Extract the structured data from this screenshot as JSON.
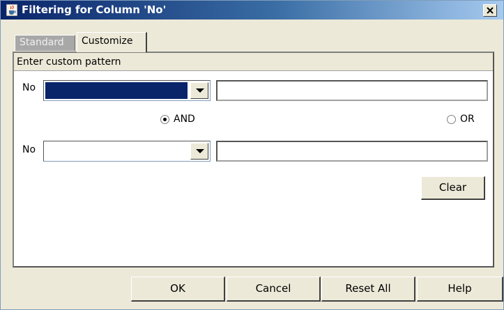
{
  "window": {
    "title": "Filtering for Column 'No'",
    "icon": "java-cup-icon",
    "close_symbol": "✕"
  },
  "tabs": [
    {
      "label": "Standard",
      "active": false
    },
    {
      "label": "Customize",
      "active": true
    }
  ],
  "panel": {
    "header": "Enter custom pattern",
    "row1": {
      "label": "No",
      "operator_value": "",
      "pattern_value": ""
    },
    "logic": {
      "and_label": "AND",
      "or_label": "OR",
      "selected": "AND"
    },
    "row2": {
      "label": "No",
      "operator_value": "",
      "pattern_value": ""
    },
    "clear_label": "Clear"
  },
  "footer": {
    "ok_label": "OK",
    "cancel_label": "Cancel",
    "reset_label": "Reset All",
    "help_label": "Help"
  },
  "colors": {
    "title_start": "#0a246a",
    "selection": "#0a246a",
    "window_bg": "#ece9d8"
  }
}
